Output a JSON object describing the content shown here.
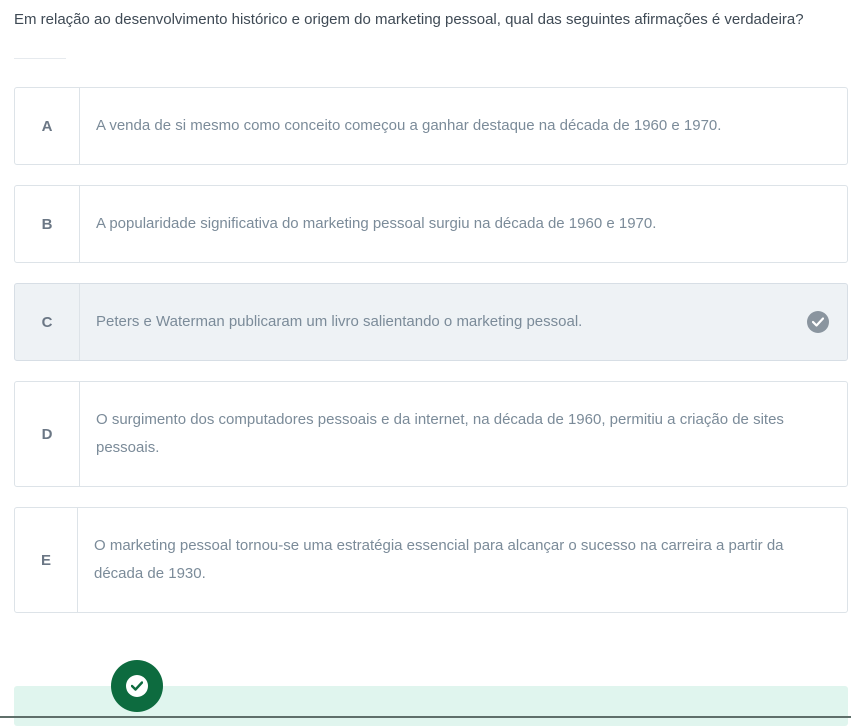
{
  "question": {
    "text": "Em relação ao desenvolvimento histórico e origem do marketing pessoal, qual das seguintes afirmações é verdadeira?"
  },
  "options": [
    {
      "letter": "A",
      "text": "A venda de si mesmo como conceito começou a ganhar destaque na década de 1960 e 1970.",
      "selected": false
    },
    {
      "letter": "B",
      "text": "A popularidade significativa do marketing pessoal surgiu na década de 1960 e 1970.",
      "selected": false
    },
    {
      "letter": "C",
      "text": "Peters e Waterman publicaram um livro salientando o marketing pessoal.",
      "selected": true
    },
    {
      "letter": "D",
      "text": "O surgimento dos computadores pessoais e da internet, na década de 1960, permitiu a criação de sites pessoais.",
      "selected": false
    },
    {
      "letter": "E",
      "text": "O marketing pessoal tornou-se uma estratégia essencial para alcançar o sucesso na carreira a partir da década de 1930.",
      "selected": false
    }
  ],
  "icons": {
    "selected_check": "check-circle-icon",
    "result_badge": "success-check-icon"
  },
  "colors": {
    "selected_bg": "#eef2f5",
    "check_gray": "#8a959f",
    "success_green": "#0d6b3f",
    "feedback_bg": "#e0f5ee"
  }
}
